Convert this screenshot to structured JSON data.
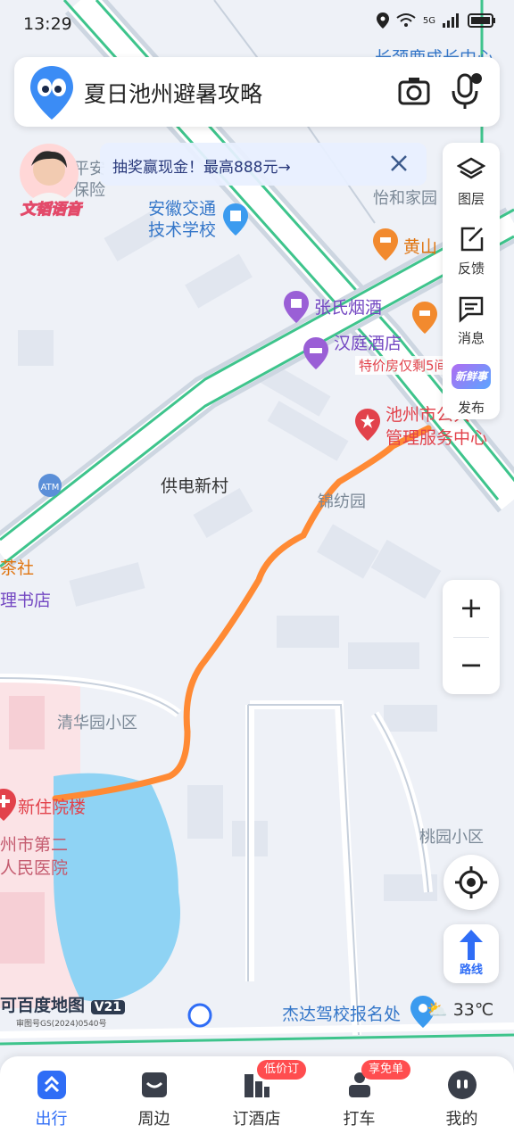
{
  "status": {
    "time": "13:29",
    "network": "5G"
  },
  "search": {
    "text": "夏日池州避暑攻略"
  },
  "promo": {
    "text": "抽奖赢现金！最高888元→"
  },
  "avatar": {
    "label": "文韬语音"
  },
  "side_tools": [
    {
      "label": "图层",
      "icon": "layers-icon"
    },
    {
      "label": "反馈",
      "icon": "edit-icon"
    },
    {
      "label": "消息",
      "icon": "message-icon"
    },
    {
      "label": "发布",
      "icon": "new-post-icon",
      "badge": "新鲜事"
    }
  ],
  "zoom": {
    "in": "+",
    "out": "−"
  },
  "route": {
    "label": "路线"
  },
  "map_labels": {
    "school": "安徽交通\n技术学校",
    "zhang": "张氏烟酒",
    "hanting": "汉庭酒店",
    "hanting_deal": "特价房仅剩5间",
    "center": "池州市公共\n管理服务中心",
    "gongdian": "供电新村",
    "jinfang": "锦纺园",
    "yihe": "怡和家园",
    "huangshan": "黄山",
    "chashe": "茶社",
    "shudian": "理书店",
    "qinghua": "清华园小区",
    "hospital_bldg": "新住院楼",
    "hospital": "州市第二\n人民医院",
    "taoyuan": "桃园小区",
    "jieda": "杰达驾校报名处",
    "chengzhang": "长颈鹿成长中心",
    "baoxian": "平安\n保险"
  },
  "map_footer": {
    "logo": "可百度地图",
    "version": "V21",
    "license": "审图号GS(2024)0540号"
  },
  "weather": {
    "temp": "33℃"
  },
  "tabs": [
    {
      "label": "出行",
      "active": true,
      "icon": "travel-icon"
    },
    {
      "label": "周边",
      "active": false,
      "icon": "nearby-icon"
    },
    {
      "label": "订酒店",
      "active": false,
      "icon": "hotel-icon",
      "badge": "低价订"
    },
    {
      "label": "打车",
      "active": false,
      "icon": "taxi-icon",
      "badge": "享免单"
    },
    {
      "label": "我的",
      "active": false,
      "icon": "profile-icon"
    }
  ],
  "colors": {
    "route": "#ff8a34",
    "road_green": "#3ec48c",
    "water": "#8fd3f4",
    "accent": "#2f6df6"
  }
}
